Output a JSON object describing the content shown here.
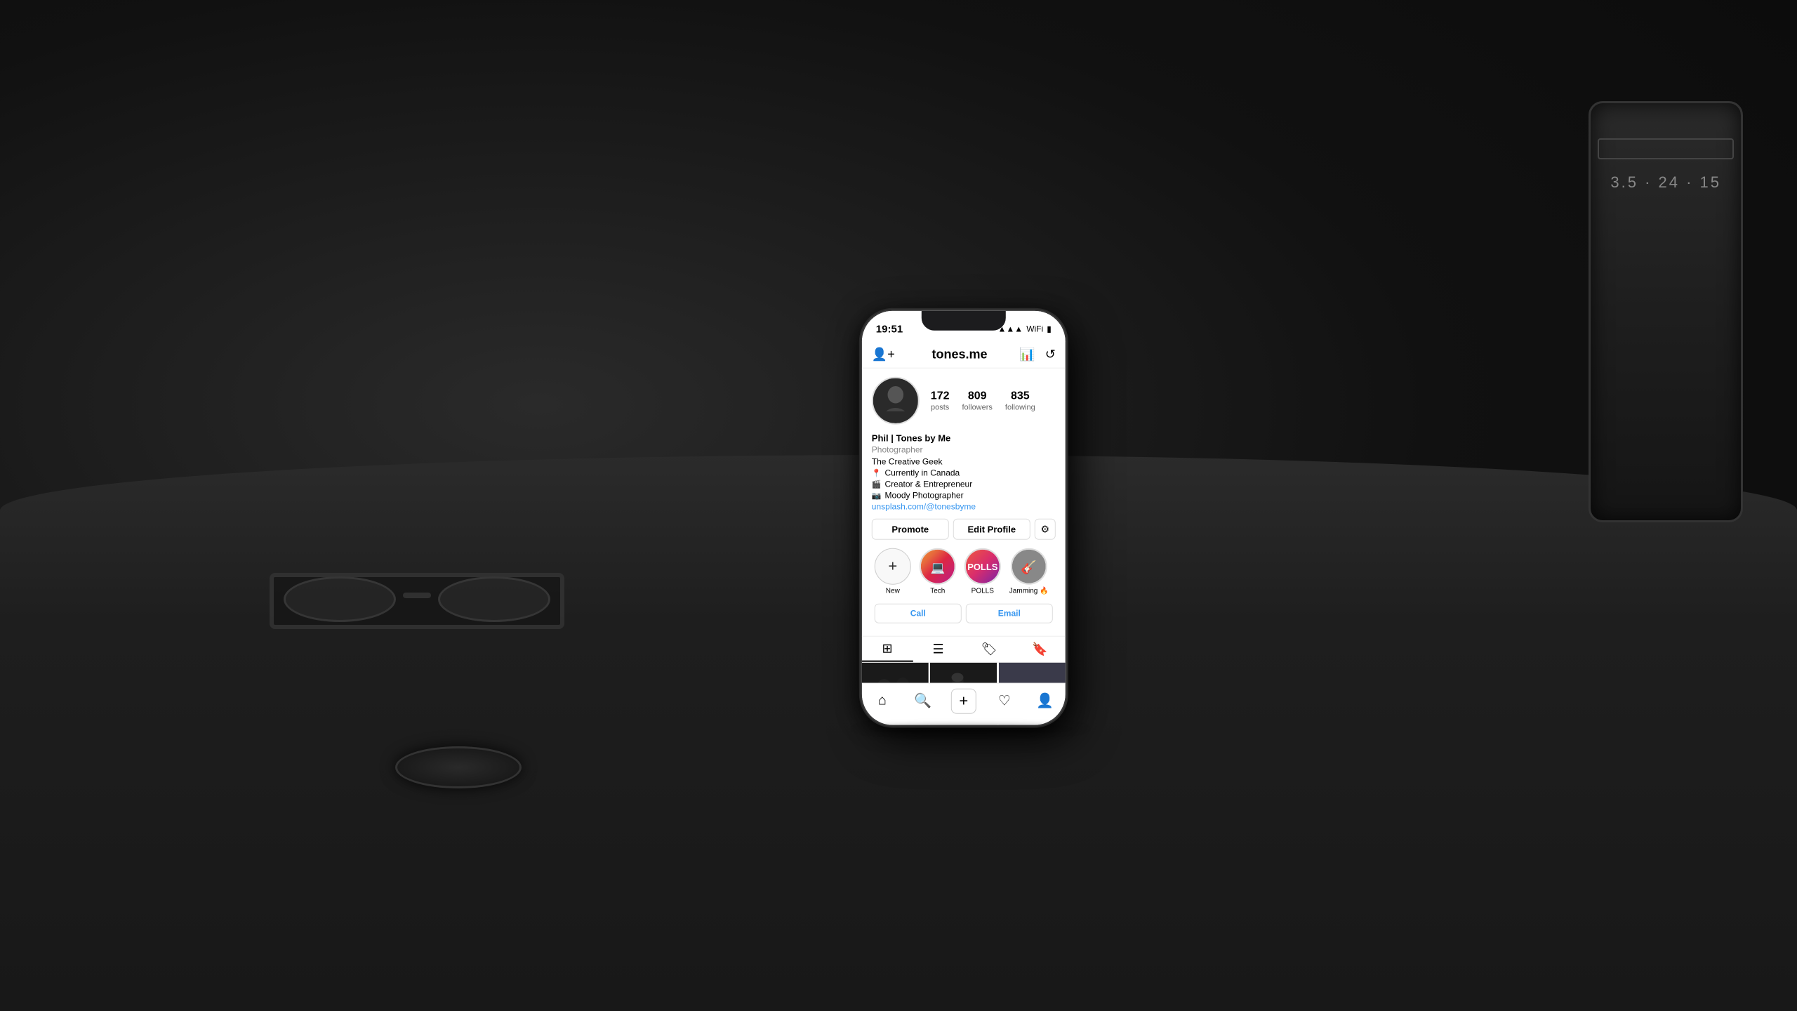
{
  "scene": {
    "bg": "dark photography desk scene"
  },
  "phone": {
    "status": {
      "time": "19:51",
      "signal": "●●●",
      "wifi": "wifi",
      "battery": "battery"
    },
    "header": {
      "username": "tones.me",
      "icon_stats": "📊",
      "icon_history": "🕐"
    },
    "profile": {
      "posts_count": "172",
      "posts_label": "posts",
      "followers_count": "809",
      "followers_label": "followers",
      "following_count": "835",
      "following_label": "following",
      "btn_promote": "Promote",
      "btn_edit": "Edit Profile",
      "name": "Phil | Tones by Me",
      "subtitle": "Photographer",
      "bio_line1": "The Creative Geek",
      "bio_line2": "Currently in Canada",
      "bio_line3": "Creator & Entrepreneur",
      "bio_line4": "Moody Photographer",
      "bio_link": "unsplash.com/@tonesbyme"
    },
    "highlights": [
      {
        "label": "New",
        "type": "new"
      },
      {
        "label": "Tech",
        "type": "tech"
      },
      {
        "label": "POLLS",
        "type": "polls"
      },
      {
        "label": "Jamming 🔥",
        "type": "jamming"
      }
    ],
    "contact": {
      "call_label": "Call",
      "email_label": "Email"
    },
    "tabs": [
      {
        "icon": "⊞",
        "active": true
      },
      {
        "icon": "☰",
        "active": false
      },
      {
        "icon": "🏷",
        "active": false
      },
      {
        "icon": "🔖",
        "active": false
      }
    ],
    "nav": [
      {
        "icon": "⌂",
        "name": "home"
      },
      {
        "icon": "🔍",
        "name": "search"
      },
      {
        "icon": "⊕",
        "name": "add"
      },
      {
        "icon": "♡",
        "name": "activity"
      },
      {
        "icon": "👤",
        "name": "profile"
      }
    ]
  }
}
